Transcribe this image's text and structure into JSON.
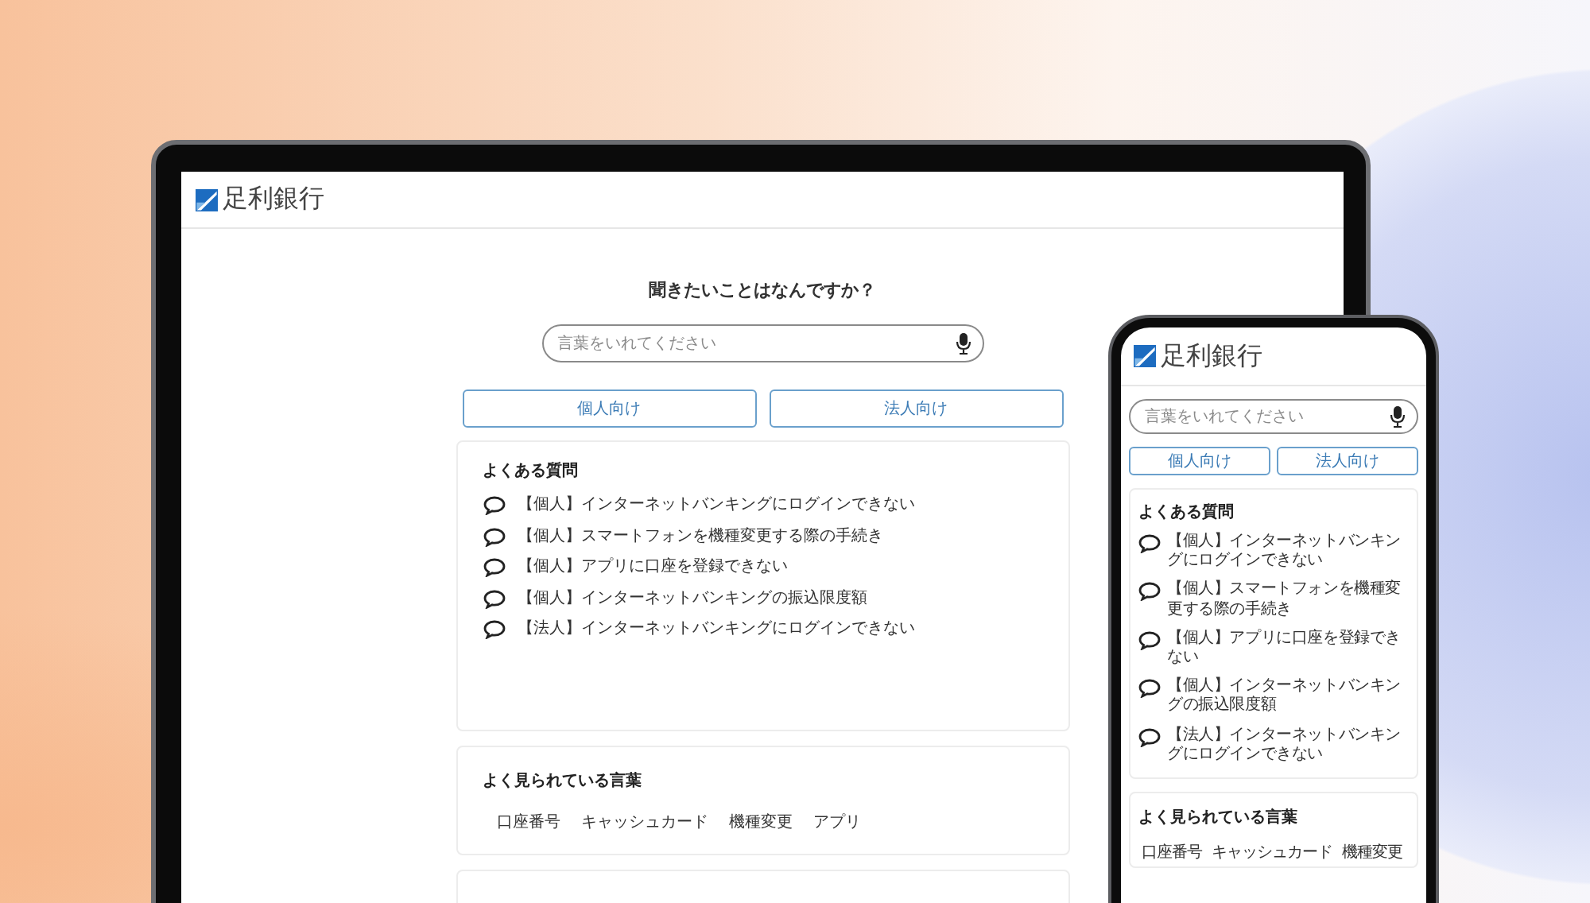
{
  "laptop": {
    "logo": "足利銀行",
    "heading": "聞きたいことはなんですか？",
    "search": {
      "placeholder": "言葉をいれてください"
    },
    "audience_buttons": [
      {
        "label": "個人向け"
      },
      {
        "label": "法人向け"
      }
    ],
    "faq": {
      "title": "よくある質問",
      "items": [
        {
          "text": "【個人】インターネットバンキングにログインできない"
        },
        {
          "text": "【個人】スマートフォンを機種変更する際の手続き"
        },
        {
          "text": "【個人】アプリに口座を登録できない"
        },
        {
          "text": "【個人】インターネットバンキングの振込限度額"
        },
        {
          "text": "【法人】インターネットバンキングにログインできない"
        }
      ]
    },
    "popular_words": {
      "title": "よく見られている言葉",
      "items": [
        "口座番号",
        "キャッシュカード",
        "機種変更",
        "アプリ"
      ]
    }
  },
  "phone": {
    "logo": "足利銀行",
    "search": {
      "placeholder": "言葉をいれてください"
    },
    "audience_buttons": [
      {
        "label": "個人向け"
      },
      {
        "label": "法人向け"
      }
    ],
    "faq": {
      "title": "よくある質問",
      "items": [
        {
          "text": "【個人】インターネットバンキングにログインできない"
        },
        {
          "text": "【個人】スマートフォンを機種変更する際の手続き"
        },
        {
          "text": "【個人】アプリに口座を登録できない"
        },
        {
          "text": "【個人】インターネットバンキングの振込限度額"
        },
        {
          "text": "【法人】インターネットバンキングにログインできない"
        }
      ]
    },
    "popular_words": {
      "title": "よく見られている言葉",
      "items": [
        "口座番号",
        "キャッシュカード",
        "機種変更"
      ]
    }
  }
}
